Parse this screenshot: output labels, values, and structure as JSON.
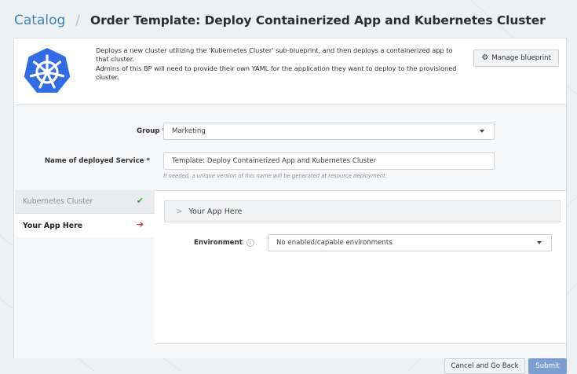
{
  "header": {
    "breadcrumb_root": "Catalog",
    "separator": "/",
    "title": "Order Template: Deploy Containerized App and Kubernetes Cluster"
  },
  "blueprint": {
    "description_line1": "Deploys a new cluster utilizing the 'Kubernetes Cluster' sub-blueprint, and then deploys a containerized app to that cluster.",
    "description_line2": "Admins of this BP will need to provide their own YAML for the application they want to deploy to the provisioned cluster.",
    "manage_button": "Manage blueprint",
    "logo_icon": "kubernetes-logo-icon"
  },
  "form": {
    "group_label": "Group *",
    "group_value": "Marketing",
    "service_name_label": "Name of deployed Service *",
    "service_name_value": "Template: Deploy Containerized App and Kubernetes Cluster",
    "service_name_help": "If needed, a unique version of this name will be generated at resource deployment."
  },
  "tabs": [
    {
      "label": "Kubernetes Cluster",
      "status_icon": "✔",
      "status": "complete"
    },
    {
      "label": "Your App Here",
      "status_icon": "➔",
      "status": "pending"
    }
  ],
  "panel": {
    "accordion_title": "Your App Here",
    "environment_label": "Environment",
    "environment_value": "No enabled/capable environments"
  },
  "footer": {
    "cancel_button": "Cancel and Go Back",
    "submit_button": "Submit"
  },
  "colors": {
    "accent": "#3e83c1",
    "k8s_blue": "#326ce5",
    "success": "#3fa63f",
    "danger": "#d02b2b",
    "submit": "#7c9fd1"
  }
}
